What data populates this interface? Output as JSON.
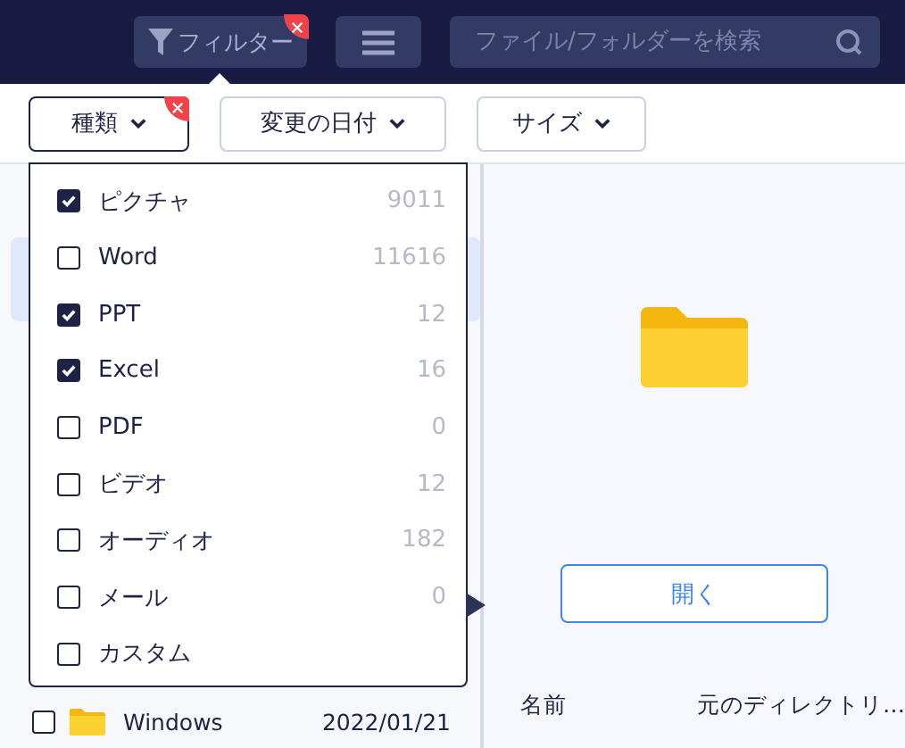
{
  "header": {
    "filter_button": {
      "label": "フィルター",
      "active": true
    },
    "search": {
      "placeholder": "ファイル/フォルダーを検索"
    }
  },
  "filters": [
    {
      "label": "種類",
      "open": true,
      "active": true
    },
    {
      "label": "変更の日付",
      "open": false,
      "active": false
    },
    {
      "label": "サイズ",
      "open": false,
      "active": false
    }
  ],
  "type_menu": [
    {
      "label": "ピクチャ",
      "count": "9011",
      "checked": true
    },
    {
      "label": "Word",
      "count": "11616",
      "checked": false
    },
    {
      "label": "PPT",
      "count": "12",
      "checked": true
    },
    {
      "label": "Excel",
      "count": "16",
      "checked": true
    },
    {
      "label": "PDF",
      "count": "0",
      "checked": false
    },
    {
      "label": "ビデオ",
      "count": "12",
      "checked": false
    },
    {
      "label": "オーディオ",
      "count": "182",
      "checked": false
    },
    {
      "label": "メール",
      "count": "0",
      "checked": false
    },
    {
      "label": "カスタム",
      "checked": false
    }
  ],
  "file_list": [
    {
      "name": "Windows",
      "date": "2022/01/21",
      "checked": false
    }
  ],
  "details": {
    "open_button": "開く",
    "properties": [
      {
        "label": "名前",
        "value": "元のディレクトリ…"
      }
    ]
  }
}
